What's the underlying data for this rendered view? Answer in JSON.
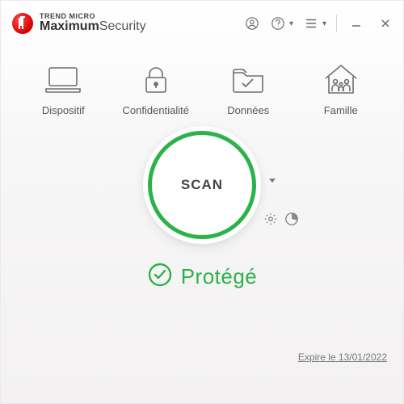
{
  "brand": {
    "top_line": "TREND MICRO",
    "main_bold": "Maximum",
    "main_light": "Security"
  },
  "categories": [
    {
      "id": "device",
      "label": "Dispositif"
    },
    {
      "id": "privacy",
      "label": "Confidentialité"
    },
    {
      "id": "data",
      "label": "Données"
    },
    {
      "id": "family",
      "label": "Famille"
    }
  ],
  "scan": {
    "label": "SCAN"
  },
  "status": {
    "text": "Protégé"
  },
  "footer": {
    "expiry_text": "Expire le 13/01/2022"
  },
  "colors": {
    "accent_green": "#2bb24a",
    "brand_red": "#d40000"
  }
}
